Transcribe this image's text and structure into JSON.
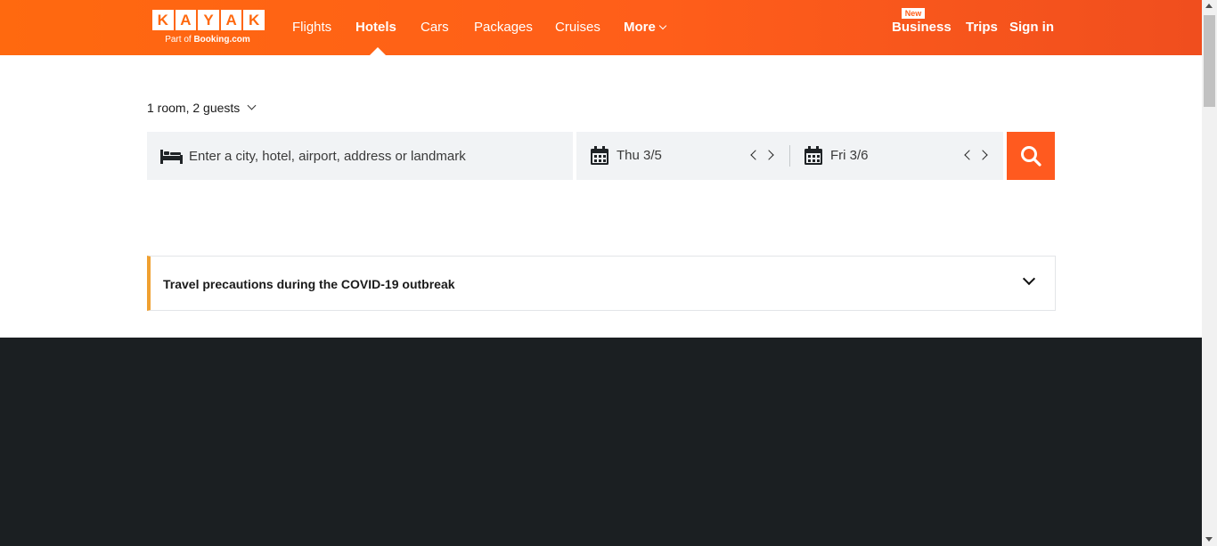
{
  "header": {
    "logo_letters": [
      "K",
      "A",
      "Y",
      "A",
      "K"
    ],
    "logo_sub_prefix": "Part of ",
    "logo_sub_brand": "Booking.com",
    "nav": [
      {
        "label": "Flights"
      },
      {
        "label": "Hotels",
        "active": true
      },
      {
        "label": "Cars"
      },
      {
        "label": "Packages"
      },
      {
        "label": "Cruises"
      },
      {
        "label": "More"
      }
    ],
    "right": {
      "new_badge": "New",
      "business": "Business",
      "trips": "Trips",
      "sign_in": "Sign in"
    },
    "colors": {
      "accent": "#ff690f",
      "accent_end": "#f04e1e"
    }
  },
  "search": {
    "guests": "1 room, 2 guests",
    "destination_placeholder": "Enter a city, hotel, airport, address or landmark",
    "destination_value": "",
    "checkin": "Thu 3/5",
    "checkout": "Fri 3/6",
    "icons": {
      "destination": "bed-icon",
      "date": "calendar-icon",
      "submit": "search-icon"
    },
    "button_color": "#ff5a1f"
  },
  "alert": {
    "title": "Travel precautions during the COVID-19 outbreak",
    "accent_color": "#f0a030"
  },
  "footer": {
    "background": "#1b1f22"
  }
}
